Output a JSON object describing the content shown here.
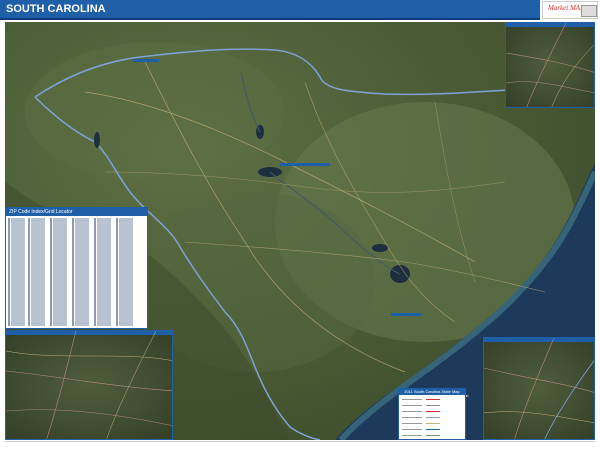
{
  "header": {
    "title": "SOUTH CAROLINA"
  },
  "logo": {
    "text": "Market MAPS",
    "icon": "market-maps-logo"
  },
  "map": {
    "type": "satellite",
    "state": "South Carolina",
    "colors": {
      "land": "#4d5f37",
      "ocean": "#1d3a5a",
      "shallow": "#3e6f7f",
      "border": "#7fa3d6",
      "road": "#c9b07a",
      "brand": "#1f5fa8"
    }
  },
  "zip_index": {
    "title": "ZIP Code Index/Grid Locator"
  },
  "legend": {
    "title": "2011 South Carolina State Map"
  },
  "compass": {
    "icon": "north-arrow-icon"
  }
}
